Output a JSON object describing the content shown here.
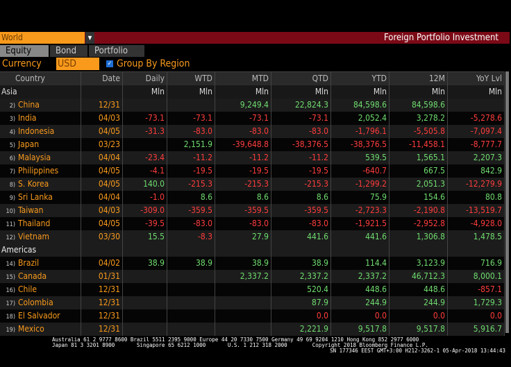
{
  "header": {
    "selector": "World",
    "title": "Foreign Portfolio Investment"
  },
  "tabs": [
    "Equity",
    "Bond",
    "Portfolio"
  ],
  "controls": {
    "currency_label": "Currency",
    "currency_value": "USD",
    "group_label": "Group By Region",
    "group_checked": true
  },
  "columns": [
    "Country",
    "Date",
    "Daily",
    "WTD",
    "MTD",
    "QTD",
    "YTD",
    "12M",
    "YoY Lvl"
  ],
  "unit": "Mln",
  "colors": {
    "positive": "#6fdc6f",
    "negative": "#ff3c3c",
    "accent": "#f99a1c",
    "titlebar": "#7b0a16"
  },
  "groups": [
    {
      "region": "Asia",
      "rows": [
        {
          "num": "2)",
          "country": "China",
          "date": "12/31",
          "vals": [
            "",
            "",
            "9,249.4",
            "22,824.3",
            "84,598.6",
            "84,598.6",
            ""
          ]
        },
        {
          "num": "3)",
          "country": "India",
          "date": "04/03",
          "vals": [
            "-73.1",
            "-73.1",
            "-73.1",
            "-73.1",
            "2,052.4",
            "3,278.2",
            "-5,278.6"
          ]
        },
        {
          "num": "4)",
          "country": "Indonesia",
          "date": "04/05",
          "vals": [
            "-31.3",
            "-83.0",
            "-83.0",
            "-83.0",
            "-1,796.1",
            "-5,505.8",
            "-7,097.4"
          ]
        },
        {
          "num": "5)",
          "country": "Japan",
          "date": "03/23",
          "vals": [
            "",
            "2,151.9",
            "-39,648.8",
            "-38,376.5",
            "-38,376.5",
            "-11,458.1",
            "-8,777.7"
          ]
        },
        {
          "num": "6)",
          "country": "Malaysia",
          "date": "04/04",
          "vals": [
            "-23.4",
            "-11.2",
            "-11.2",
            "-11.2",
            "539.5",
            "1,565.1",
            "2,207.3"
          ]
        },
        {
          "num": "7)",
          "country": "Philippines",
          "date": "04/05",
          "vals": [
            "-4.1",
            "-19.5",
            "-19.5",
            "-19.5",
            "-640.7",
            "667.5",
            "842.9"
          ]
        },
        {
          "num": "8)",
          "country": "S. Korea",
          "date": "04/05",
          "vals": [
            "140.0",
            "-215.3",
            "-215.3",
            "-215.3",
            "-1,299.2",
            "2,051.3",
            "-12,279.9"
          ]
        },
        {
          "num": "9)",
          "country": "Sri Lanka",
          "date": "04/04",
          "vals": [
            "-1.0",
            "8.6",
            "8.6",
            "8.6",
            "75.9",
            "154.6",
            "80.8"
          ]
        },
        {
          "num": "10)",
          "country": "Taiwan",
          "date": "04/03",
          "vals": [
            "-309.0",
            "-359.5",
            "-359.5",
            "-359.5",
            "-2,723.3",
            "-2,190.8",
            "-13,519.7"
          ]
        },
        {
          "num": "11)",
          "country": "Thailand",
          "date": "04/05",
          "vals": [
            "-39.5",
            "-83.0",
            "-83.0",
            "-83.0",
            "-1,921.5",
            "-2,952.8",
            "-4,928.0"
          ]
        },
        {
          "num": "12)",
          "country": "Vietnam",
          "date": "03/30",
          "vals": [
            "15.5",
            "-8.3",
            "27.9",
            "441.6",
            "441.6",
            "1,306.8",
            "1,478.5"
          ]
        }
      ]
    },
    {
      "region": "Americas",
      "rows": [
        {
          "num": "14)",
          "country": "Brazil",
          "date": "04/02",
          "vals": [
            "38.9",
            "38.9",
            "38.9",
            "38.9",
            "114.4",
            "3,123.9",
            "716.9"
          ]
        },
        {
          "num": "15)",
          "country": "Canada",
          "date": "01/31",
          "vals": [
            "",
            "",
            "2,337.2",
            "2,337.2",
            "2,337.2",
            "46,712.3",
            "8,000.1"
          ]
        },
        {
          "num": "16)",
          "country": "Chile",
          "date": "12/31",
          "vals": [
            "",
            "",
            "",
            "520.4",
            "448.6",
            "448.6",
            "-857.1"
          ]
        },
        {
          "num": "17)",
          "country": "Colombia",
          "date": "12/31",
          "vals": [
            "",
            "",
            "",
            "87.9",
            "244.9",
            "244.9",
            "1,729.3"
          ]
        },
        {
          "num": "18)",
          "country": "El Salvador",
          "date": "12/31",
          "vals": [
            "",
            "",
            "",
            "0.0",
            "0.0",
            "0.0",
            "0.0"
          ]
        },
        {
          "num": "19)",
          "country": "Mexico",
          "date": "12/31",
          "vals": [
            "",
            "",
            "",
            "2,221.9",
            "9,517.8",
            "9,517.8",
            "5,916.7"
          ]
        }
      ]
    }
  ],
  "footer": {
    "line1": "Australia 61 2 9777 8600 Brazil 5511 2395 9000 Europe 44 20 7330 7500 Germany 49 69 9204 1210 Hong Kong 852 2977 6000",
    "line2": "Japan 81 3 3201 8900       Singapore 65 6212 1000       U.S. 1 212 318 2000        Copyright 2018 Bloomberg Finance L.P.",
    "line3": "SN 177346 EEST GMT+3:00 H212-3262-1 05-Apr-2018 13:44:43"
  }
}
